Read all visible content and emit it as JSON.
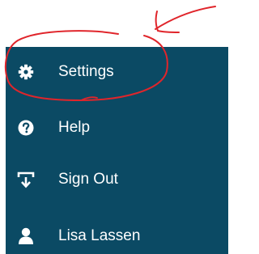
{
  "menu": {
    "items": [
      {
        "label": "Settings",
        "icon": "gear-icon"
      },
      {
        "label": "Help",
        "icon": "question-circle-icon"
      },
      {
        "label": "Sign Out",
        "icon": "sign-out-icon"
      },
      {
        "label": "Lisa Lassen",
        "icon": "user-icon"
      }
    ]
  },
  "colors": {
    "panel_background": "#0b4a64",
    "text": "#ffffff",
    "annotation": "#e0252b"
  }
}
